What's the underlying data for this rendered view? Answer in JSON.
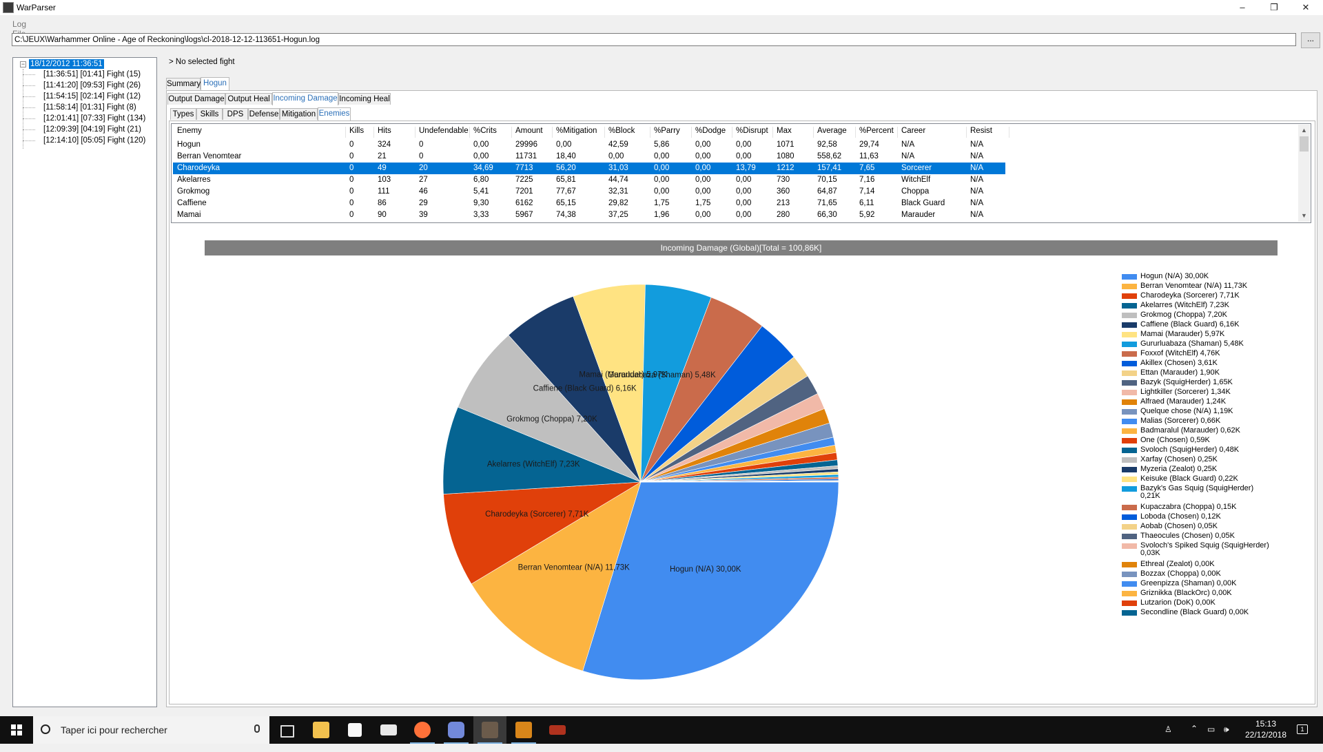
{
  "window": {
    "title": "WarParser",
    "controls": {
      "minimize": "–",
      "maximize": "❐",
      "close": "✕"
    }
  },
  "menu": {
    "log_file": "Log File"
  },
  "log_path": {
    "value": "C:\\JEUX\\Warhammer Online - Age of Reckoning\\logs\\cl-2018-12-12-113651-Hogun.log",
    "browse_label": "..."
  },
  "tree": {
    "root": {
      "label": "18/12/2012 11:36:51",
      "toggle": "−"
    },
    "items": [
      {
        "label": "[11:36:51] [01:41] Fight (15)"
      },
      {
        "label": "[11:41:20] [09:53] Fight (26)"
      },
      {
        "label": "[11:54:15] [02:14] Fight (12)"
      },
      {
        "label": "[11:58:14] [01:31] Fight (8)"
      },
      {
        "label": "[12:01:41] [07:33] Fight (134)"
      },
      {
        "label": "[12:09:39] [04:19] Fight (21)"
      },
      {
        "label": "[12:14:10] [05:05] Fight (120)"
      }
    ]
  },
  "status": {
    "selected_fight": "> No selected fight"
  },
  "tabs_level1": [
    {
      "label": "Summary"
    },
    {
      "label": "Hogun"
    }
  ],
  "tabs_level2": [
    {
      "label": "Output Damage"
    },
    {
      "label": "Output Heal"
    },
    {
      "label": "Incoming Damage"
    },
    {
      "label": "Incoming Heal"
    }
  ],
  "tabs_level3": [
    {
      "label": "Types"
    },
    {
      "label": "Skills"
    },
    {
      "label": "DPS"
    },
    {
      "label": "Defense"
    },
    {
      "label": "Mitigation"
    },
    {
      "label": "Enemies"
    }
  ],
  "table": {
    "columns": [
      "Enemy",
      "Kills",
      "Hits",
      "Undefendable",
      "%Crits",
      "Amount",
      "%Mitigation",
      "%Block",
      "%Parry",
      "%Dodge",
      "%Disrupt",
      "Max",
      "Average",
      "%Percent",
      "Career",
      "Resist"
    ],
    "rows": [
      [
        "Hogun",
        "0",
        "324",
        "0",
        "0,00",
        "29996",
        "0,00",
        "42,59",
        "5,86",
        "0,00",
        "0,00",
        "1071",
        "92,58",
        "29,74",
        "N/A",
        "N/A"
      ],
      [
        "Berran Venomtear",
        "0",
        "21",
        "0",
        "0,00",
        "11731",
        "18,40",
        "0,00",
        "0,00",
        "0,00",
        "0,00",
        "1080",
        "558,62",
        "11,63",
        "N/A",
        "N/A"
      ],
      [
        "Charodeyka",
        "0",
        "49",
        "20",
        "34,69",
        "7713",
        "56,20",
        "31,03",
        "0,00",
        "0,00",
        "13,79",
        "1212",
        "157,41",
        "7,65",
        "Sorcerer",
        "N/A"
      ],
      [
        "Akelarres",
        "0",
        "103",
        "27",
        "6,80",
        "7225",
        "65,81",
        "44,74",
        "0,00",
        "0,00",
        "0,00",
        "730",
        "70,15",
        "7,16",
        "WitchElf",
        "N/A"
      ],
      [
        "Grokmog",
        "0",
        "111",
        "46",
        "5,41",
        "7201",
        "77,67",
        "32,31",
        "0,00",
        "0,00",
        "0,00",
        "360",
        "64,87",
        "7,14",
        "Choppa",
        "N/A"
      ],
      [
        "Caffiene",
        "0",
        "86",
        "29",
        "9,30",
        "6162",
        "65,15",
        "29,82",
        "1,75",
        "1,75",
        "0,00",
        "213",
        "71,65",
        "6,11",
        "Black Guard",
        "N/A"
      ],
      [
        "Mamai",
        "0",
        "90",
        "39",
        "3,33",
        "5967",
        "74,38",
        "37,25",
        "1,96",
        "0,00",
        "0,00",
        "280",
        "66,30",
        "5,92",
        "Marauder",
        "N/A"
      ]
    ],
    "selected_row": 2
  },
  "chart_data": {
    "type": "pie",
    "title": "Incoming Damage (Global)[Total = 100,86K]",
    "slices": [
      {
        "label": "Hogun (N/A) 30,00K",
        "value": 30.0,
        "color": "#418cf0"
      },
      {
        "label": "Berran Venomtear (N/A) 11,73K",
        "value": 11.73,
        "color": "#fcb441"
      },
      {
        "label": "Charodeyka (Sorcerer) 7,71K",
        "value": 7.71,
        "color": "#e0400a"
      },
      {
        "label": "Akelarres (WitchElf) 7,23K",
        "value": 7.23,
        "color": "#056492"
      },
      {
        "label": "Grokmog (Choppa) 7,20K",
        "value": 7.2,
        "color": "#bfbfbf"
      },
      {
        "label": "Caffiene (Black Guard) 6,16K",
        "value": 6.16,
        "color": "#1a3b69"
      },
      {
        "label": "Mamai (Marauder) 5,97K",
        "value": 5.97,
        "color": "#ffe382"
      },
      {
        "label": "Gururluabaza (Shaman) 5,48K",
        "value": 5.48,
        "color": "#129cdd"
      },
      {
        "label": "Foxxof (WitchElf) 4,76K",
        "value": 4.76,
        "color": "#ca6b4b"
      },
      {
        "label": "Akillex (Chosen) 3,61K",
        "value": 3.61,
        "color": "#005cdb"
      },
      {
        "label": "Ettan (Marauder) 1,90K",
        "value": 1.9,
        "color": "#f3d288"
      },
      {
        "label": "Bazyk (SquigHerder) 1,65K",
        "value": 1.65,
        "color": "#506381"
      },
      {
        "label": "Lightkiller (Sorcerer) 1,34K",
        "value": 1.34,
        "color": "#f1b9a8"
      },
      {
        "label": "Alfraed (Marauder) 1,24K",
        "value": 1.24,
        "color": "#e0830a"
      },
      {
        "label": "Quelque chose (N/A) 1,19K",
        "value": 1.19,
        "color": "#7893be"
      },
      {
        "label": "Malias (Sorcerer) 0,66K",
        "value": 0.66,
        "color": "#418cf0"
      },
      {
        "label": "Badmaralul (Marauder) 0,62K",
        "value": 0.62,
        "color": "#fcb441"
      },
      {
        "label": "One (Chosen) 0,59K",
        "value": 0.59,
        "color": "#e0400a"
      },
      {
        "label": "Svoloch (SquigHerder) 0,48K",
        "value": 0.48,
        "color": "#056492"
      },
      {
        "label": "Xarfay (Chosen) 0,25K",
        "value": 0.25,
        "color": "#bfbfbf"
      },
      {
        "label": "Myzeria (Zealot) 0,25K",
        "value": 0.25,
        "color": "#1a3b69"
      },
      {
        "label": "Keisuke (Black Guard) 0,22K",
        "value": 0.22,
        "color": "#ffe382"
      },
      {
        "label": "Bazyk's Gas Squig (SquigHerder) 0,21K",
        "value": 0.21,
        "color": "#129cdd"
      },
      {
        "label": "Kupaczabra (Choppa) 0,15K",
        "value": 0.15,
        "color": "#ca6b4b"
      },
      {
        "label": "Loboda (Chosen) 0,12K",
        "value": 0.12,
        "color": "#005cdb"
      },
      {
        "label": "Aobab (Chosen) 0,05K",
        "value": 0.05,
        "color": "#f3d288"
      },
      {
        "label": "Thaeocules (Chosen) 0,05K",
        "value": 0.05,
        "color": "#506381"
      },
      {
        "label": "Svoloch's Spiked Squig (SquigHerder) 0,03K",
        "value": 0.03,
        "color": "#f1b9a8"
      },
      {
        "label": "Ethreal (Zealot) 0,00K",
        "value": 0.0,
        "color": "#e0830a"
      },
      {
        "label": "Bozzax (Choppa) 0,00K",
        "value": 0.0,
        "color": "#7893be"
      },
      {
        "label": "Greenpizza (Shaman) 0,00K",
        "value": 0.0,
        "color": "#418cf0"
      },
      {
        "label": "Griznikka (BlackOrc) 0,00K",
        "value": 0.0,
        "color": "#fcb441"
      },
      {
        "label": "Lutzarion (DoK) 0,00K",
        "value": 0.0,
        "color": "#e0400a"
      },
      {
        "label": "Secondline (Black Guard) 0,00K",
        "value": 0.0,
        "color": "#056492"
      }
    ],
    "labeled_slices": 8,
    "legend_position": "right"
  },
  "taskbar": {
    "search_placeholder": "Taper ici pour rechercher",
    "apps": [
      "task-view",
      "file-explorer",
      "store",
      "mail",
      "firefox",
      "discord",
      "warparser",
      "rift-launcher",
      "war-launcher"
    ],
    "time": "15:13",
    "date": "22/12/2018",
    "notifications": "1"
  }
}
